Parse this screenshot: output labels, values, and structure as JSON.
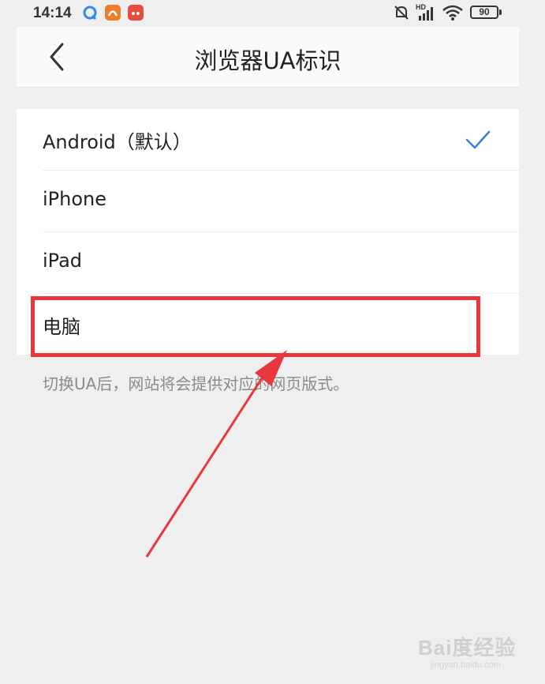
{
  "status_bar": {
    "time": "14:14",
    "battery": "90",
    "network_label": "HD"
  },
  "header": {
    "title": "浏览器UA标识"
  },
  "ua_options": [
    {
      "label": "Android（默认）",
      "selected": true
    },
    {
      "label": "iPhone",
      "selected": false
    },
    {
      "label": "iPad",
      "selected": false
    },
    {
      "label": "电脑",
      "selected": false
    }
  ],
  "hint": "切换UA后，网站将会提供对应的网页版式。",
  "watermark": {
    "brand": "Bai度经验",
    "url": "jingyan.baidu.com"
  },
  "colors": {
    "accent": "#3d7fd1",
    "annotation": "#e8383d"
  },
  "icons": {
    "back": "chevron-left-icon",
    "check": "checkmark-icon"
  }
}
